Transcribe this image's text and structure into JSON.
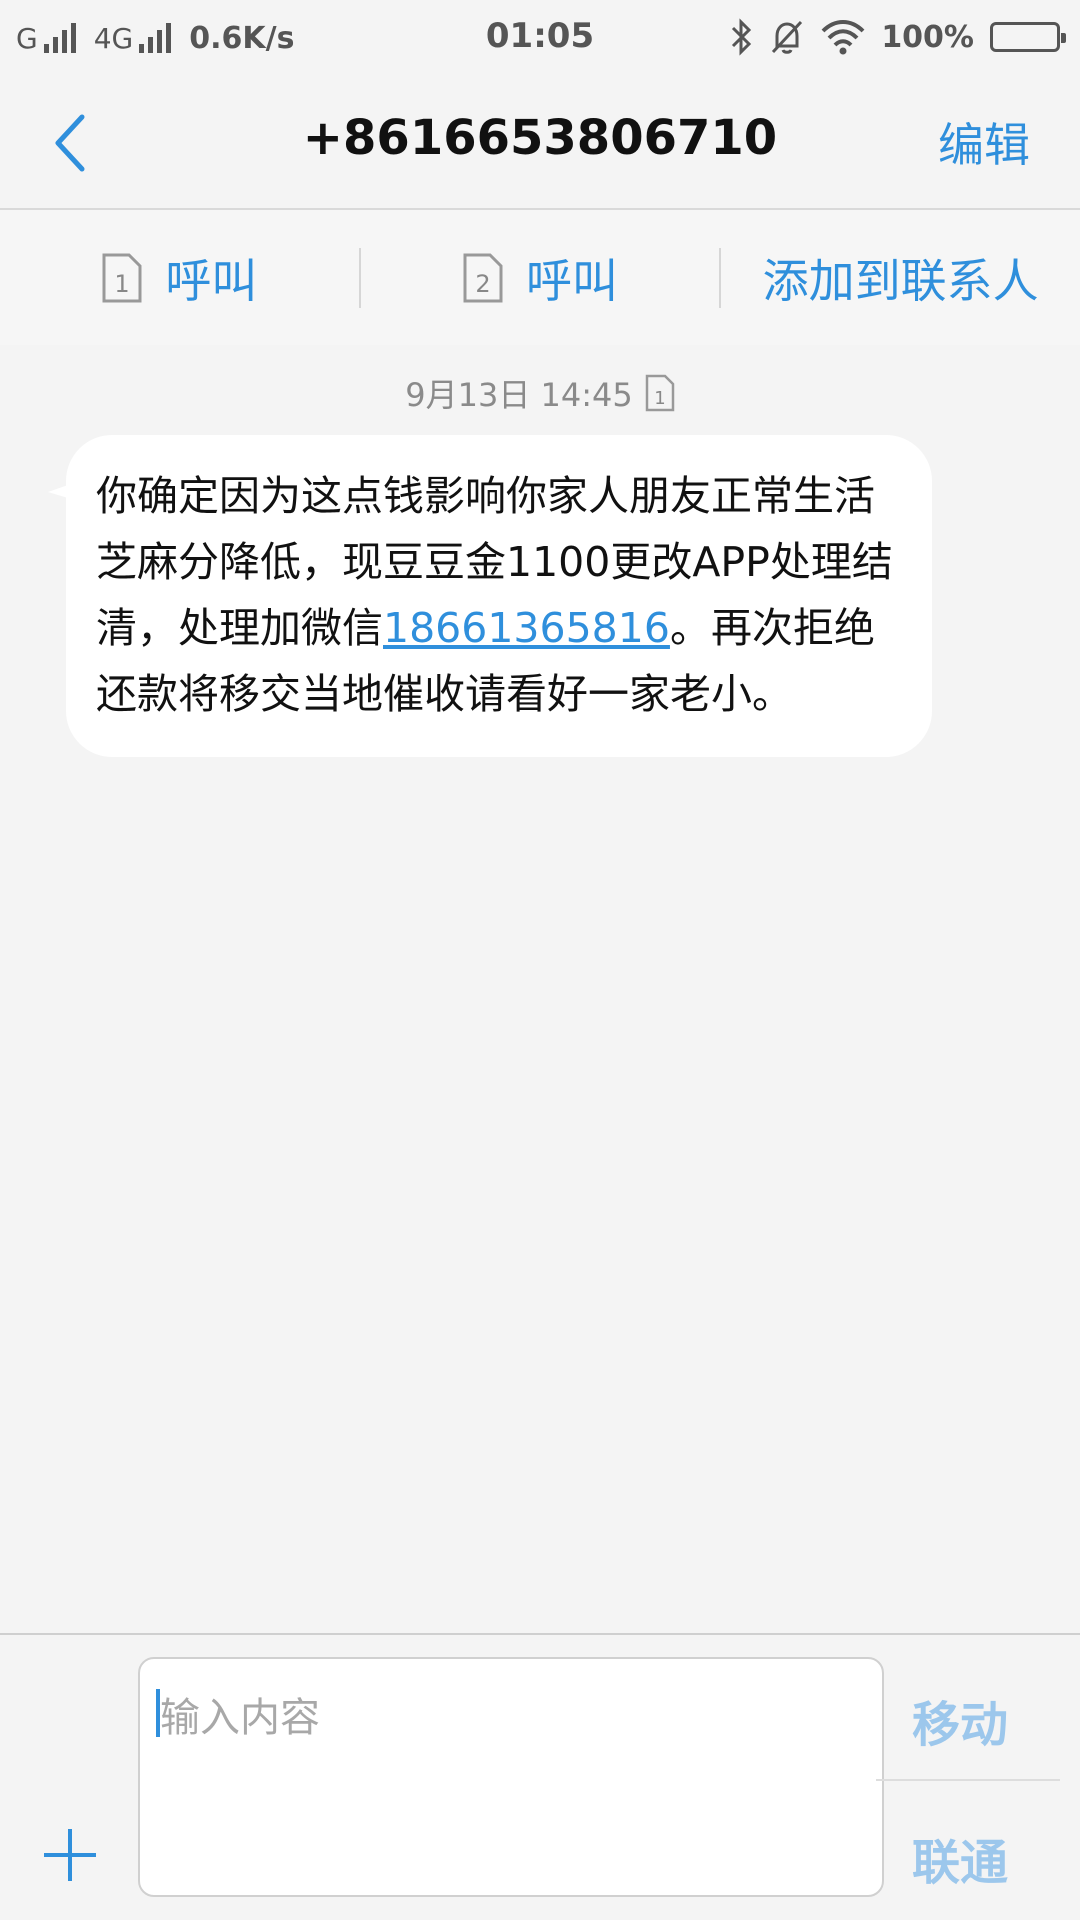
{
  "status_bar": {
    "sim1_type": "G",
    "sim2_type": "4G",
    "net_speed": "0.6K/s",
    "time": "01:05",
    "battery": "100%",
    "battery_level": 1.0
  },
  "header": {
    "title": "+8616653806710",
    "edit_label": "编辑"
  },
  "actions": {
    "call_sim1_label": "呼叫",
    "call_sim2_label": "呼叫",
    "sim1_number": "1",
    "sim2_number": "2",
    "add_contact_label": "添加到联系人"
  },
  "conversation": {
    "date": "9月13日 14:45",
    "date_sim": "1",
    "message": {
      "part1": "你确定因为这点钱影响你家人朋友正常生活芝麻分降低，现豆豆金1100更改APP处理结清，处理加微信",
      "link": "18661365816",
      "part2": "。再次拒绝还款将移交当地催收请看好一家老小。"
    }
  },
  "composer": {
    "placeholder": "输入内容",
    "send_sim1_label": "移动",
    "send_sim2_label": "联通"
  },
  "colors": {
    "accent": "#2f8fdc",
    "disabled_accent": "#9cc7ec",
    "background": "#f4f4f4"
  }
}
